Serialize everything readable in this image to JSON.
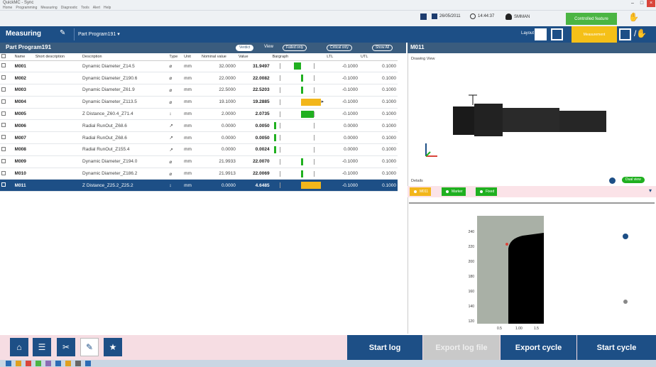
{
  "window": {
    "app_title": "QuickMC - Sync",
    "menu": [
      "Home",
      "Programming",
      "Measuring",
      "Diagnostic",
      "Tools",
      "Alert",
      "Help"
    ]
  },
  "status": {
    "date": "26/05/2011",
    "time": "14:44:37",
    "user": "SMMAN",
    "green_button": "Controlled feature"
  },
  "header": {
    "measuring_label": "Measuring",
    "program_label": "Part Program191",
    "layout_label": "Layout",
    "yellow_button": "Measurement"
  },
  "grid": {
    "title": "Part Program191",
    "pills": [
      "Verdict",
      "Failed only",
      "Critical only",
      "Show All"
    ],
    "view_label": "View",
    "columns": [
      "Name",
      "Short description",
      "Description",
      "Type",
      "Unit",
      "Nominal value",
      "Value",
      "Bargraph",
      "LTL",
      "UTL"
    ],
    "rows": [
      {
        "name": "M001",
        "short": "",
        "desc": "Dynamic Diameter_Z14.5",
        "type": "⌀",
        "unit": "mm",
        "nominal": "32.0000",
        "value": "31.9497",
        "ltl": "-0.1000",
        "utl": "0.1000"
      },
      {
        "name": "M002",
        "short": "",
        "desc": "Dynamic Diameter_Z190.6",
        "type": "⌀",
        "unit": "mm",
        "nominal": "22.0000",
        "value": "22.0082",
        "ltl": "-0.1000",
        "utl": "0.1000"
      },
      {
        "name": "M003",
        "short": "",
        "desc": "Dynamic Diameter_Z61.9",
        "type": "⌀",
        "unit": "mm",
        "nominal": "22.5000",
        "value": "22.5203",
        "ltl": "-0.1000",
        "utl": "0.1000"
      },
      {
        "name": "M004",
        "short": "",
        "desc": "Dynamic Diameter_Z113.5",
        "type": "⌀",
        "unit": "mm",
        "nominal": "19.1000",
        "value": "19.2885",
        "ltl": "-0.1000",
        "utl": "0.1000"
      },
      {
        "name": "M005",
        "short": "",
        "desc": "Z Distance_Z60.4_Z71.4",
        "type": "↕",
        "unit": "mm",
        "nominal": "2.0000",
        "value": "2.0735",
        "ltl": "-0.1000",
        "utl": "0.1000"
      },
      {
        "name": "M006",
        "short": "",
        "desc": "Radial RunOut_Z68.6",
        "type": "↗",
        "unit": "mm",
        "nominal": "0.0000",
        "value": "0.0050",
        "ltl": "0.0000",
        "utl": "0.1000"
      },
      {
        "name": "M007",
        "short": "",
        "desc": "Radial RunOut_Z68.6",
        "type": "↗",
        "unit": "mm",
        "nominal": "0.0000",
        "value": "0.0050",
        "ltl": "0.0000",
        "utl": "0.1000"
      },
      {
        "name": "M008",
        "short": "",
        "desc": "Radial RunOut_Z155.4",
        "type": "↗",
        "unit": "mm",
        "nominal": "0.0000",
        "value": "0.0024",
        "ltl": "0.0000",
        "utl": "0.1000"
      },
      {
        "name": "M009",
        "short": "",
        "desc": "Dynamic Diameter_Z194.0",
        "type": "⌀",
        "unit": "mm",
        "nominal": "21.9933",
        "value": "22.0070",
        "ltl": "-0.1000",
        "utl": "0.1000"
      },
      {
        "name": "M010",
        "short": "",
        "desc": "Dynamic Diameter_Z186.2",
        "type": "⌀",
        "unit": "mm",
        "nominal": "21.9913",
        "value": "22.0069",
        "ltl": "-0.1000",
        "utl": "0.1000"
      },
      {
        "name": "M011",
        "short": "",
        "desc": "Z Distance_Z25.2_Z25.2",
        "type": "↕",
        "unit": "mm",
        "nominal": "0.0000",
        "value": "4.6485",
        "ltl": "-0.1000",
        "utl": "0.1000"
      }
    ]
  },
  "right": {
    "title": "M011",
    "drawing_label": "Drawing View",
    "details_label": "Details",
    "tabs": [
      "M011",
      "Marker",
      "Fixed"
    ],
    "right_pill": "Dual view",
    "ticks_y": [
      "240",
      "220",
      "200",
      "180",
      "160",
      "140",
      "120"
    ],
    "ticks_x": [
      "0.5",
      "1.00",
      "1.5"
    ]
  },
  "bottom": {
    "start_log": "Start log",
    "export_log": "Export log file",
    "export_cycle": "Export cycle",
    "start_cycle": "Start cycle"
  },
  "colors": {
    "navy": "#1d4f86",
    "slate": "#3a5c7e",
    "green": "#20b020",
    "yellow": "#f2b61b"
  }
}
